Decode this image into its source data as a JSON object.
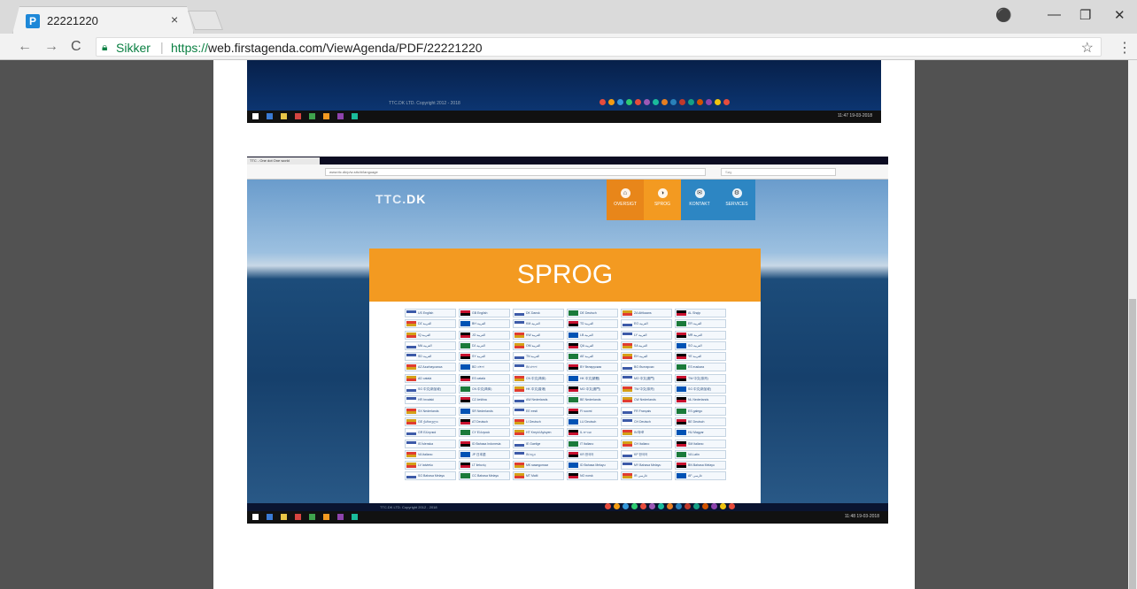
{
  "tab": {
    "title": "22221220",
    "close": "×"
  },
  "window_controls": {
    "profile": "⚫",
    "minimize": "—",
    "restore": "❐",
    "close": "✕"
  },
  "nav": {
    "back": "←",
    "forward": "→",
    "reload": "C"
  },
  "address": {
    "secure_label": "Sikker",
    "url_scheme": "https://",
    "url_rest": "web.firstagenda.com/ViewAgenda/PDF/22221220"
  },
  "icons": {
    "star": "☆",
    "menu": "⋮"
  },
  "top_shot": {
    "copyright": "TTC.DK LTD. Copyright 2012 - 2018",
    "clock": "11:47  19-03-2018"
  },
  "shot": {
    "ff_tab": "TTC - One dot One world",
    "ff_url": "www.ttc.dk/p/w-sitc/#/language",
    "ff_search": "Søg",
    "logo": "TTC.",
    "logo_bold": "DK",
    "nav": [
      {
        "icon": "⌂",
        "label": "OVERSIGT",
        "color": "#e8861a"
      },
      {
        "icon": "◑",
        "label": "SPROG",
        "color": "#f39a21"
      },
      {
        "icon": "✉",
        "label": "KONTAKT",
        "color": "#2d86c3"
      },
      {
        "icon": "⚙",
        "label": "SERVICES",
        "color": "#2d86c3"
      }
    ],
    "panel_title": "SPROG",
    "copyright": "TTC.DK LTD. Copyright 2012 - 2018",
    "clock": "11:48  19-03-2018"
  },
  "languages": [
    "US English",
    "GB English",
    "DK Dansk",
    "DE Deutsch",
    "ZA Afrikaans",
    "AL Shqip",
    "DZ العربية",
    "BH العربية",
    "KM العربية",
    "TD العربية",
    "EG العربية",
    "ER العربية",
    "IQ العربية",
    "JO العربية",
    "KW العربية",
    "LB العربية",
    "LY العربية",
    "MR العربية",
    "MA العربية",
    "DJ العربية",
    "OM العربية",
    "QA العربية",
    "SA العربية",
    "SO العربية",
    "SD العربية",
    "SY العربية",
    "TN العربية",
    "AE العربية",
    "EH العربية",
    "YE العربية",
    "AZ Azərbaycanca",
    "BD বাংলা",
    "IN বাংলা",
    "BY беларуская",
    "BG български",
    "ES euskara",
    "AD català",
    "ES català",
    "CN 中文(简体)",
    "HK 中文(繁體)",
    "MO 中文(澳門)",
    "TW 中文(臺灣)",
    "SG 中文(新加坡)",
    "CN 中文(简体)",
    "HK 中文(香港)",
    "MO 中文(澳門)",
    "TW 中文(臺灣)",
    "SG 中文(新加坡)",
    "HR hrvatski",
    "CZ čeština",
    "AW Nederlands",
    "BE Nederlands",
    "CW Nederlands",
    "NL Nederlands",
    "SX Nederlands",
    "SR Nederlands",
    "EE eesti",
    "FI suomi",
    "FR Français",
    "ES galego",
    "GE ქართული",
    "AT Deutsch",
    "LI Deutsch",
    "LU Deutsch",
    "CH Deutsch",
    "BE Deutsch",
    "GR Ελληνικά",
    "CY Ελληνικά",
    "HT Kreyòl Ayisyen",
    "IL עברית",
    "IN हिन्दी",
    "HU Magyar",
    "IS Íslenska",
    "ID Bahasa Indonesia",
    "IE Gaeilge",
    "IT Italiano",
    "CH Italiano",
    "SM Italiano",
    "VA Italiano",
    "JP 日本語",
    "IN ಕನ್ನಡ",
    "KR 한국어",
    "KP 한국어",
    "VA Latin",
    "LV latviešu",
    "LT lietuvių",
    "MK македонски",
    "ID Bahasa Melayu",
    "MY Bahasa Melayu",
    "BN Bahasa Melayu",
    "SG Bahasa Melayu",
    "CC Bahasa Melayu",
    "MT Malti",
    "NO norsk",
    "IR فارسی",
    "AF فارسی"
  ],
  "flag_colors": [
    "#3c5aa8",
    "#c8102e",
    "#ffffff",
    "#1a7a3a",
    "#d4a017",
    "#000000",
    "#e03c31",
    "#0052b4"
  ]
}
